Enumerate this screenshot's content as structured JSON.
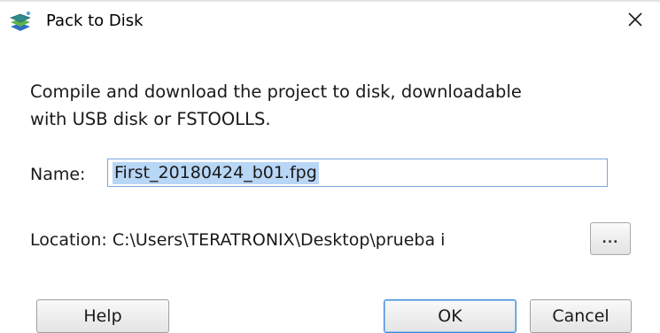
{
  "window": {
    "title": "Pack to Disk",
    "icon": "stacked-layers-app-icon",
    "close_icon": "close-icon"
  },
  "message": {
    "line1": "Compile and download the project to disk, downloadable",
    "line2": "with USB disk or FSTOOLLS."
  },
  "name_field": {
    "label": "Name:",
    "value": "First_20180424_b01.fpg"
  },
  "location": {
    "label": "Location:",
    "path": "C:\\Users\\TERATRONIX\\Desktop\\prueba i",
    "browse_label": "..."
  },
  "buttons": {
    "help": "Help",
    "ok": "OK",
    "cancel": "Cancel"
  },
  "colors": {
    "selection": "#b8d6f5",
    "focus_border": "#3c8ad8",
    "icon_teal": "#2e8b8b",
    "icon_green": "#5db44a",
    "icon_blue": "#2f6fbf"
  }
}
